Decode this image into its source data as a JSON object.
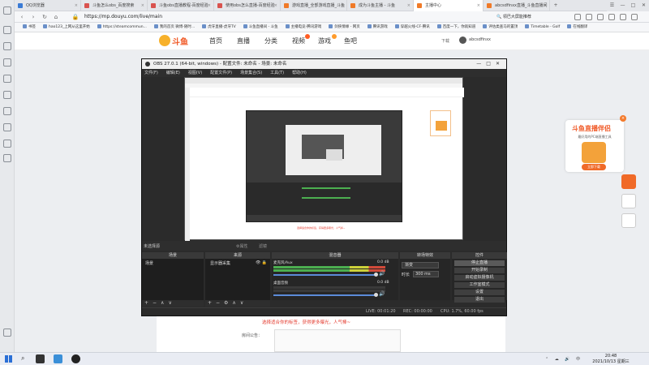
{
  "browser": {
    "tabs": [
      {
        "label": "QQ浏览器",
        "active": false
      },
      {
        "label": "斗鱼怎么obs_百度搜索",
        "active": false
      },
      {
        "label": "斗鱼obs直播教程-百度经验",
        "active": false
      },
      {
        "label": "使用obs怎么直播-百度经验",
        "active": false
      },
      {
        "label": "游戏直播_全部游戏直播_斗鱼",
        "active": false
      },
      {
        "label": "成为斗鱼主播 - 斗鱼",
        "active": false
      },
      {
        "label": "主播中心",
        "active": true
      },
      {
        "label": "abcsdfinxx直播_斗鱼直播间",
        "active": false
      }
    ],
    "new_tab_symbol": "+",
    "window_controls": [
      "☰",
      "—",
      "□",
      "✕"
    ],
    "url": "https://mp.douyu.com/live/main",
    "search_suggestion": "🔍 领巴大屏能推荐",
    "bookmarks": [
      "书签",
      "hao123_上网从这里开始",
      "https://steamcommun...",
      "我的首页 微博-随时...",
      "虎牙直播-虎牙TV",
      "斗鱼直播间 - 斗鱼",
      "主播电竞-腾讯游戏",
      "剑侠情缘 - 网页",
      "腾讯游戏",
      "穿越火线-CF-腾讯",
      "百度一下，你就知道",
      "评估类查马的置顶",
      "Timetable - Golf",
      "在线翻译"
    ]
  },
  "site": {
    "logo_text": "斗鱼",
    "nav": [
      "首页",
      "直播",
      "分类",
      "视频",
      "游戏",
      "鱼吧"
    ],
    "download_label": "下载",
    "username": "abcsdfinxx"
  },
  "promo": {
    "title": "斗鱼直播伴侣",
    "subtitle": "最好用的PC端直播工具",
    "button": "立即下载",
    "close": "×"
  },
  "page": {
    "tip": "选择适合你的标签，获得更多曝光，人气棒~",
    "notice_label": "房间公告："
  },
  "obs": {
    "title": "OBS 27.0.1 (64-bit, windows) - 配置文件: 未命名 - 场景: 未命名",
    "menu": [
      "文件(F)",
      "编辑(E)",
      "视图(V)",
      "配置文件(P)",
      "场景集合(S)",
      "工具(T)",
      "帮助(H)"
    ],
    "no_source": "未选择源",
    "properties": "⚙属性",
    "filters": "滤镜",
    "docks": {
      "scenes": "场景",
      "sources": "来源",
      "mixer": "混音器",
      "transitions": "转场特效",
      "controls": "控件"
    },
    "scene_item": "场景",
    "source_item": "显示器采集",
    "mixer": [
      {
        "name": "麦克风/Aux",
        "db": "0.0 dB"
      },
      {
        "name": "桌面音频",
        "db": "0.0 dB"
      }
    ],
    "transition": {
      "selected": "渐变",
      "duration_label": "时长",
      "duration_value": "300 ms"
    },
    "controls": [
      "停止直播",
      "开始录制",
      "启动虚拟摄像机",
      "工作室模式",
      "设置",
      "退出"
    ],
    "status": {
      "drop": "LIVE: 00:01:20",
      "rec": "REC: 00:00:00",
      "cpu": "CPU: 1.7%, 60.00 fps"
    }
  },
  "taskbar": {
    "time": "20:48",
    "date": "2021/10/13 星期三",
    "tray": "⌃ ☁ 🔊 中"
  }
}
